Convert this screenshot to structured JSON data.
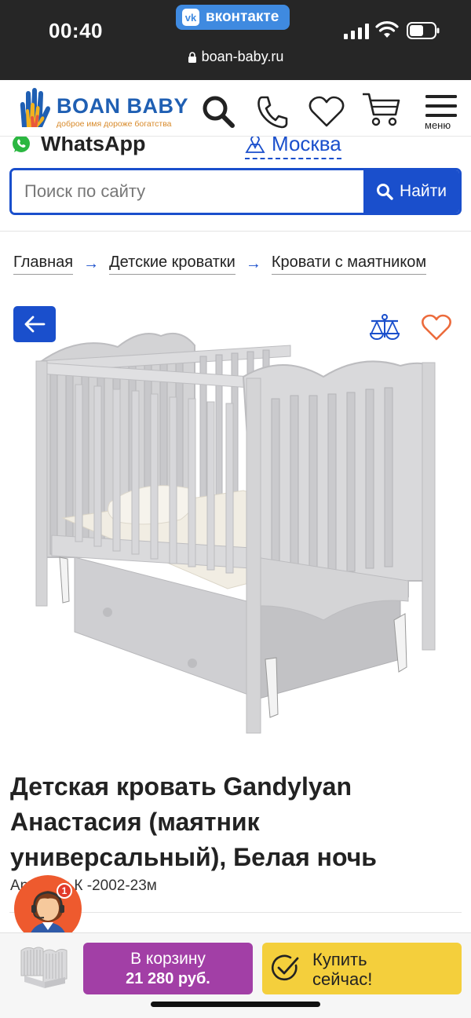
{
  "status_bar": {
    "time": "00:40",
    "vk_logo": "vk",
    "vk_label": "вконтакте",
    "url": "boan-baby.ru"
  },
  "header": {
    "logo_title": "BOAN BABY",
    "logo_tagline": "доброе имя дороже богатства",
    "menu_label": "меню",
    "icons": [
      "search-icon",
      "phone-icon",
      "heart-icon",
      "cart-icon",
      "menu-icon"
    ]
  },
  "contact_row": {
    "whatsapp_label": "WhatsApp",
    "city_label": "Москва"
  },
  "search": {
    "placeholder": "Поиск по сайту",
    "button_label": "Найти"
  },
  "breadcrumbs": [
    {
      "label": "Главная"
    },
    {
      "label": "Детские кроватки"
    },
    {
      "label": "Кровати с маятником"
    }
  ],
  "product": {
    "title": "Детская кровать Gandylyan Анастасия (маятник универсальный), Белая ночь",
    "article": "Артикул: К -2002-23м"
  },
  "consultant": {
    "badge_count": "1"
  },
  "bottom_bar": {
    "cart_label": "В корзину",
    "cart_price": "21 280 руб.",
    "buy_label_line1": "Купить",
    "buy_label_line2": "сейчас!"
  },
  "colors": {
    "accent_blue": "#1a4fcc",
    "cart_purple": "#a23fa6",
    "buy_yellow": "#f4cf3c",
    "status_bg": "#262626"
  }
}
